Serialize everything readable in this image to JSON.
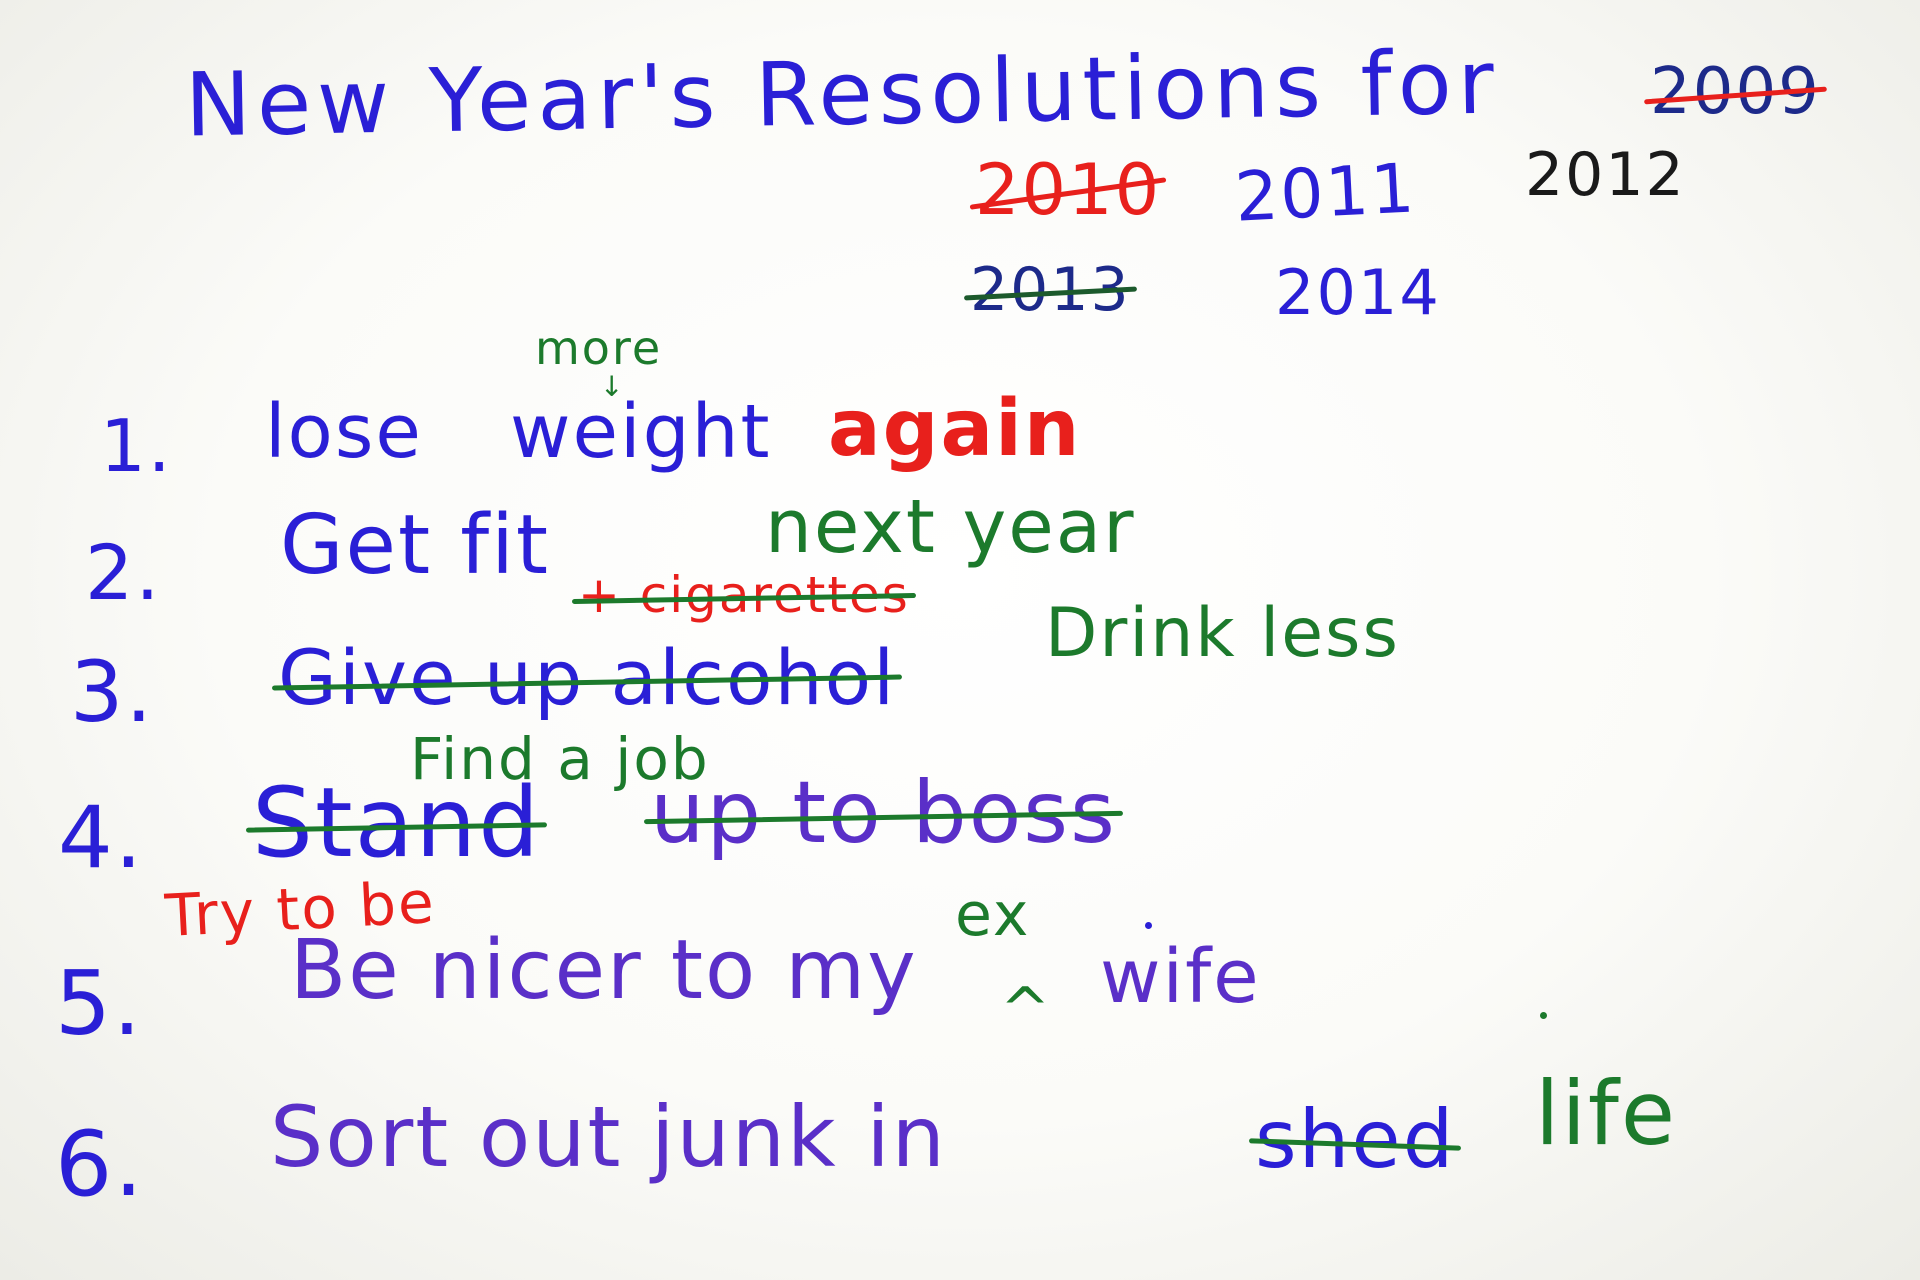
{
  "title": {
    "main": "New Year's Resolutions for",
    "years": [
      {
        "text": "2009",
        "struck": true
      },
      {
        "text": "2010",
        "struck": true
      },
      {
        "text": "2011",
        "struck": false
      },
      {
        "text": "2012",
        "struck": false
      },
      {
        "text": "2013",
        "struck": true
      },
      {
        "text": "2014",
        "struck": false
      }
    ]
  },
  "items": [
    {
      "number": "1.",
      "text_a": "lose",
      "text_b": "weight",
      "insert_above": "more",
      "addition": "again"
    },
    {
      "number": "2.",
      "text": "Get fit",
      "addition": "next year"
    },
    {
      "number": "3.",
      "struck_text": "Give up alcohol",
      "struck_insert": "+ cigarettes",
      "addition": "Drink less"
    },
    {
      "number": "4.",
      "struck_text_a": "Stand",
      "struck_text_b": "up to boss",
      "insert_above": "Find a job"
    },
    {
      "number": "5.",
      "prefix_insert": "Try to be",
      "text_a": "Be nicer to my",
      "insert_above": "ex",
      "caret": "^",
      "text_b": "wife"
    },
    {
      "number": "6.",
      "text": "Sort out junk in",
      "struck_text": "shed",
      "addition": "life"
    }
  ]
}
